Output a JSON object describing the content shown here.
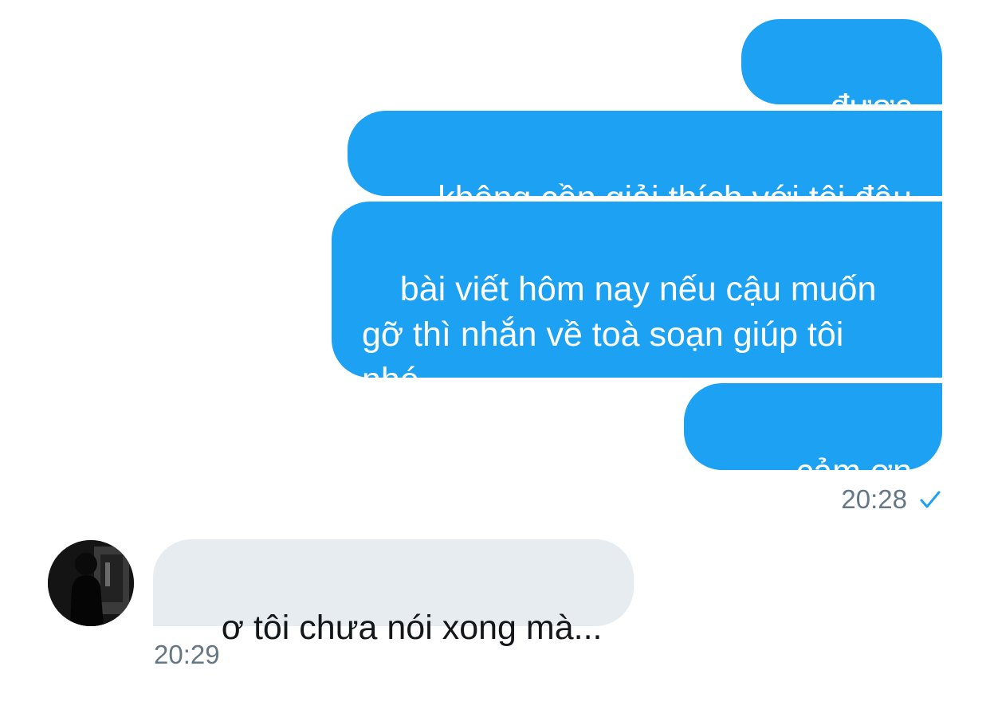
{
  "messages_out": [
    {
      "text": "được rồi"
    },
    {
      "text": "không cần giải thích với tôi đâu"
    },
    {
      "text": "bài viết hôm nay nếu cậu muốn\ngỡ thì nhắn về toà soạn giúp tôi\nnhé"
    },
    {
      "text": "cảm ơn cậu"
    }
  ],
  "out_meta": {
    "time": "20:28",
    "status_icon": "checkmark-icon",
    "accent": "#1da1f2"
  },
  "message_in": {
    "text": "ơ tôi chưa nói xong mà..."
  },
  "in_meta": {
    "time": "20:29"
  },
  "avatar": {
    "icon": "avatar-silhouette"
  },
  "colors": {
    "outgoing_bubble": "#1da1f2",
    "incoming_bubble": "#e6ecf0",
    "timestamp": "#657786"
  }
}
